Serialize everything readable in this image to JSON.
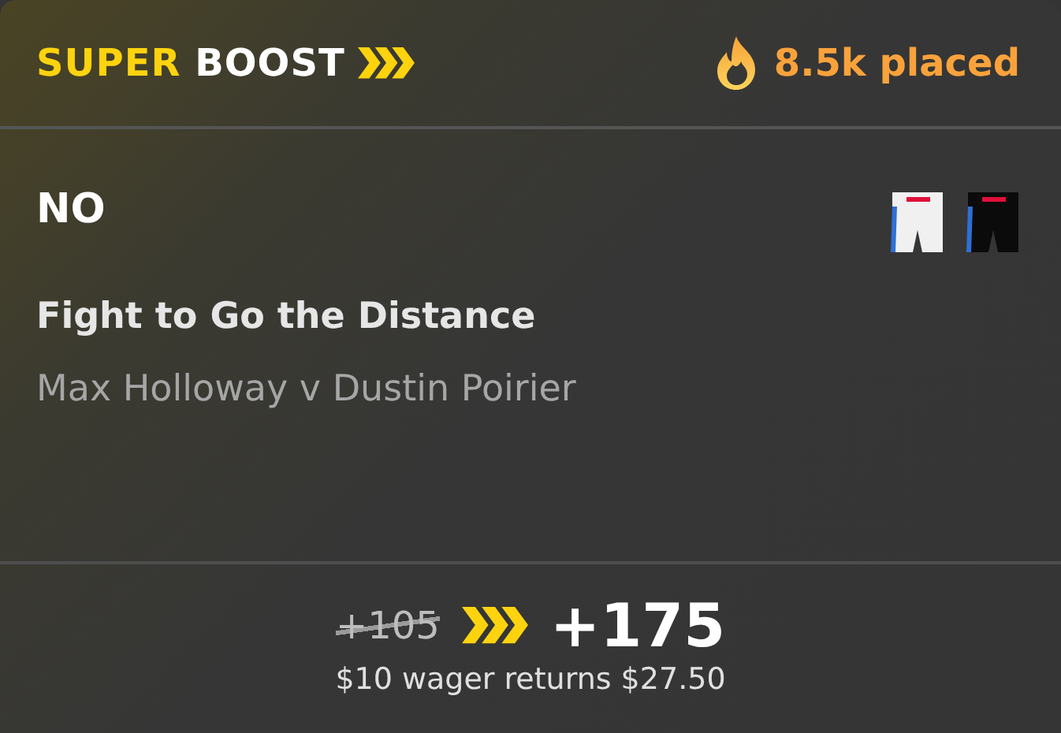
{
  "header": {
    "brand_first": "SUPER",
    "brand_second": "BOOST",
    "placed": "8.5k placed"
  },
  "bet": {
    "selection": "NO",
    "market": "Fight to Go the Distance",
    "event": "Max Holloway v Dustin Poirier"
  },
  "odds": {
    "old": "+105",
    "new": "+175",
    "returns": "$10 wager returns $27.50"
  }
}
